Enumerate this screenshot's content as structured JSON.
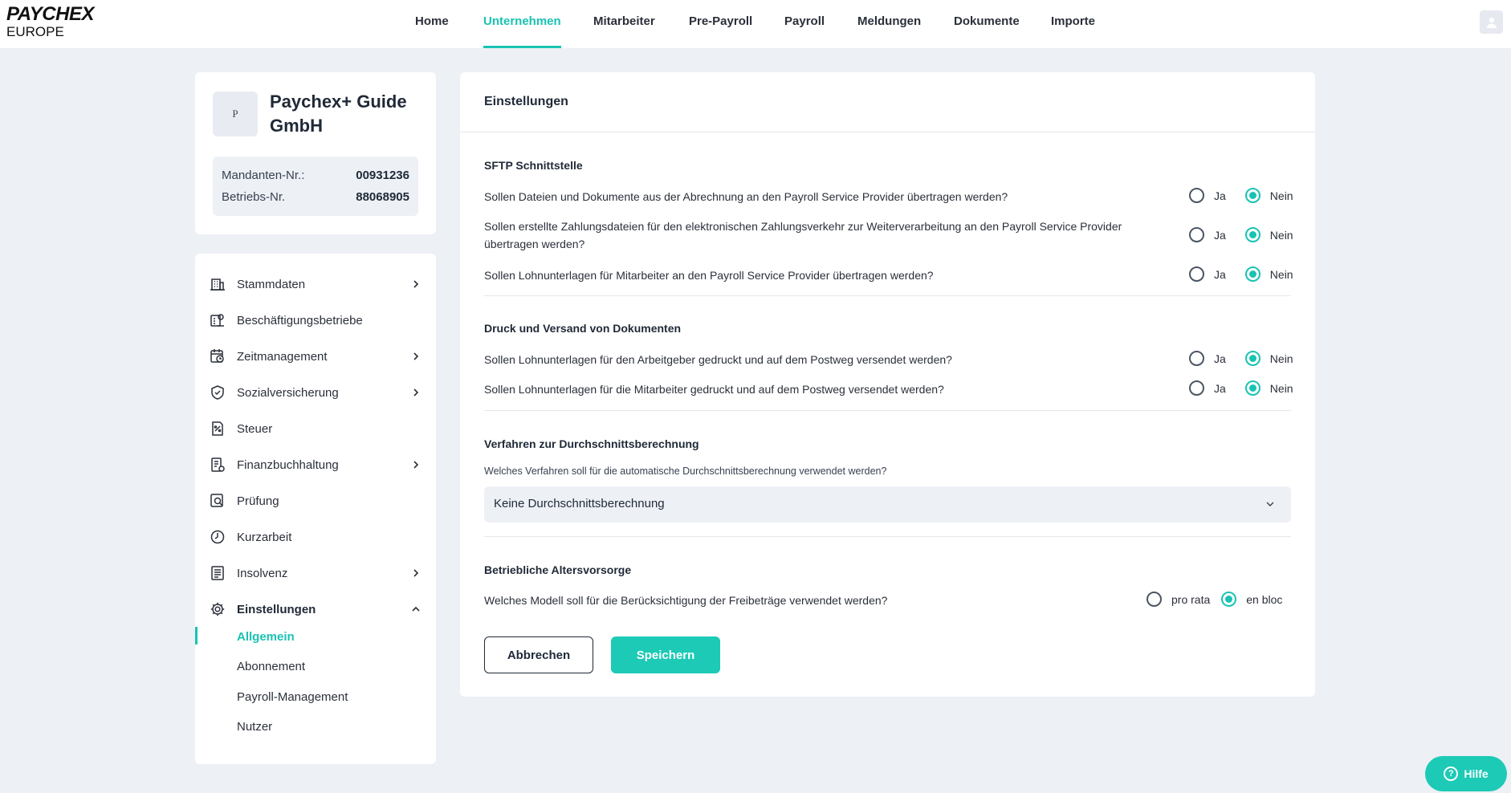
{
  "brand": {
    "line1": "PAYCHEX",
    "line2": "EUROPE"
  },
  "nav": {
    "items": [
      {
        "label": "Home"
      },
      {
        "label": "Unternehmen"
      },
      {
        "label": "Mitarbeiter"
      },
      {
        "label": "Pre-Payroll"
      },
      {
        "label": "Payroll"
      },
      {
        "label": "Meldungen"
      },
      {
        "label": "Dokumente"
      },
      {
        "label": "Importe"
      }
    ],
    "active": "Unternehmen"
  },
  "company": {
    "logo_letter": "P",
    "name": "Paychex+ Guide GmbH",
    "mandant_label": "Mandanten-Nr.:",
    "mandant_value": "00931236",
    "betrieb_label": "Betriebs-Nr.",
    "betrieb_value": "88068905"
  },
  "sidebar": {
    "items": [
      {
        "label": "Stammdaten",
        "icon": "building-icon",
        "has_chevron": true
      },
      {
        "label": "Beschäftigungsbetriebe",
        "icon": "building-settings-icon",
        "has_chevron": false
      },
      {
        "label": "Zeitmanagement",
        "icon": "calendar-clock-icon",
        "has_chevron": true
      },
      {
        "label": "Sozialversicherung",
        "icon": "shield-icon",
        "has_chevron": true
      },
      {
        "label": "Steuer",
        "icon": "percent-document-icon",
        "has_chevron": false
      },
      {
        "label": "Finanzbuchhaltung",
        "icon": "ledger-icon",
        "has_chevron": true
      },
      {
        "label": "Prüfung",
        "icon": "magnifier-document-icon",
        "has_chevron": false
      },
      {
        "label": "Kurzarbeit",
        "icon": "clock-icon",
        "has_chevron": false
      },
      {
        "label": "Insolvenz",
        "icon": "document-list-icon",
        "has_chevron": true
      },
      {
        "label": "Einstellungen",
        "icon": "gear-icon",
        "has_chevron": true,
        "expanded": true
      }
    ],
    "sub_items": [
      {
        "label": "Allgemein",
        "active": true
      },
      {
        "label": "Abonnement"
      },
      {
        "label": "Payroll-Management"
      },
      {
        "label": "Nutzer"
      }
    ]
  },
  "settings": {
    "title": "Einstellungen",
    "sections": [
      {
        "title": "SFTP Schnittstelle",
        "questions": [
          {
            "text": "Sollen Dateien und Dokumente aus der Abrechnung an den Payroll Service Provider übertragen werden?",
            "options": [
              "Ja",
              "Nein"
            ],
            "selected": "Nein"
          },
          {
            "text": "Sollen erstellte Zahlungsdateien für den elektronischen Zahlungsverkehr zur Weiterverarbeitung an den Payroll Service Provider übertragen werden?",
            "options": [
              "Ja",
              "Nein"
            ],
            "selected": "Nein"
          },
          {
            "text": "Sollen Lohnunterlagen für Mitarbeiter an den Payroll Service Provider übertragen werden?",
            "options": [
              "Ja",
              "Nein"
            ],
            "selected": "Nein"
          }
        ]
      },
      {
        "title": "Druck und Versand von Dokumenten",
        "questions": [
          {
            "text": "Sollen Lohnunterlagen für den Arbeitgeber gedruckt und auf dem Postweg versendet werden?",
            "options": [
              "Ja",
              "Nein"
            ],
            "selected": "Nein"
          },
          {
            "text": "Sollen Lohnunterlagen für die Mitarbeiter gedruckt und auf dem Postweg versendet werden?",
            "options": [
              "Ja",
              "Nein"
            ],
            "selected": "Nein"
          }
        ]
      }
    ],
    "averaging": {
      "title": "Verfahren zur Durchschnittsberechnung",
      "question": "Welches Verfahren soll für die automatische Durchschnittsberechnung verwendet werden?",
      "selected": "Keine Durchschnittsberechnung"
    },
    "pension": {
      "title": "Betriebliche Altersvorsorge",
      "question": "Welches Modell soll für die Berücksichtigung der Freibeträge verwendet werden?",
      "options": [
        "pro rata",
        "en bloc"
      ],
      "selected": "en bloc"
    },
    "cancel_label": "Abbrechen",
    "save_label": "Speichern"
  },
  "help_label": "Hilfe",
  "colors": {
    "accent": "#19c3b2",
    "background": "#edf0f5"
  }
}
